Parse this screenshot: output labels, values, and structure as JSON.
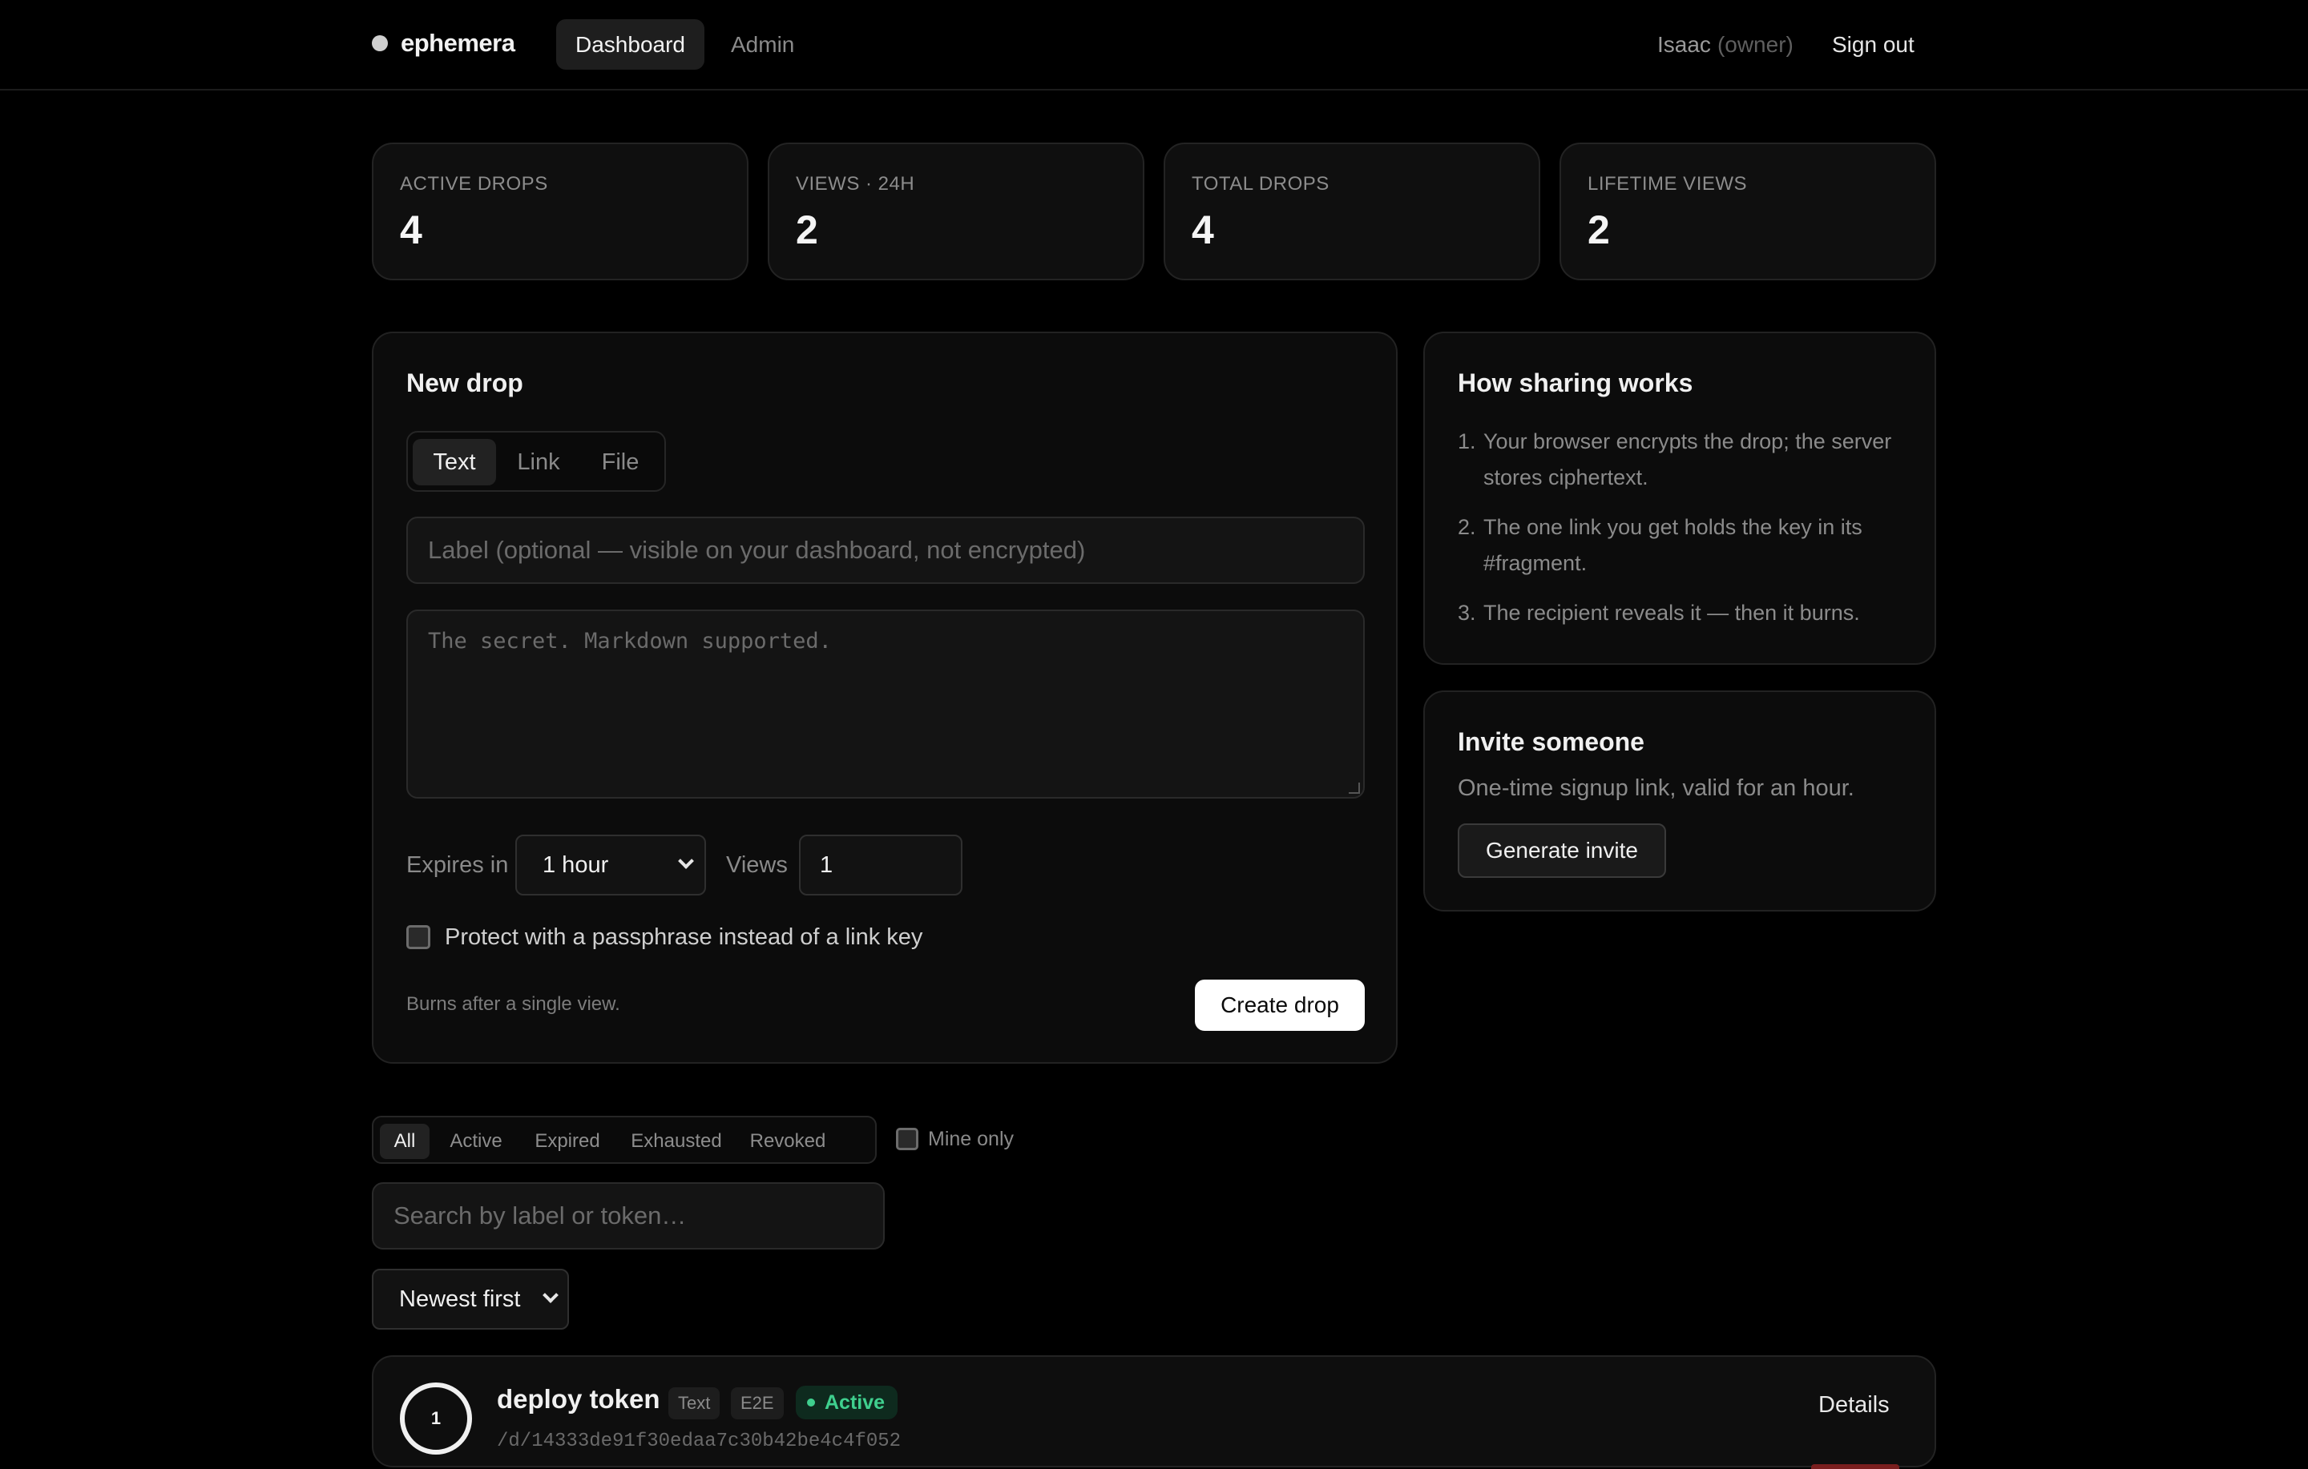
{
  "header": {
    "brand": "ephemera",
    "nav": [
      {
        "label": "Dashboard",
        "active": true
      },
      {
        "label": "Admin",
        "active": false
      }
    ],
    "user_name": "Isaac",
    "user_role": "(owner)",
    "sign_out": "Sign out"
  },
  "stats": [
    {
      "label": "ACTIVE DROPS",
      "value": "4"
    },
    {
      "label": "VIEWS · 24H",
      "value": "2"
    },
    {
      "label": "TOTAL DROPS",
      "value": "4"
    },
    {
      "label": "LIFETIME VIEWS",
      "value": "2"
    }
  ],
  "new_drop": {
    "title": "New drop",
    "tabs": [
      "Text",
      "Link",
      "File"
    ],
    "active_tab": "Text",
    "label_placeholder": "Label (optional — visible on your dashboard, not encrypted)",
    "secret_placeholder": "The secret. Markdown supported.",
    "expires_label": "Expires in",
    "expires_value": "1 hour",
    "views_label": "Views",
    "views_value": "1",
    "passphrase_label": "Protect with a passphrase instead of a link key",
    "burn_note": "Burns after a single view.",
    "create_button": "Create drop"
  },
  "how_sharing": {
    "title": "How sharing works",
    "steps": [
      {
        "num": "1.",
        "text": "Your browser encrypts the drop; the server stores ciphertext."
      },
      {
        "num": "2.",
        "text": "The one link you get holds the key in its #fragment."
      },
      {
        "num": "3.",
        "text": "The recipient reveals it — then it burns."
      }
    ]
  },
  "invite": {
    "title": "Invite someone",
    "description": "One-time signup link, valid for an hour.",
    "button": "Generate invite"
  },
  "filters": {
    "options": [
      "All",
      "Active",
      "Expired",
      "Exhausted",
      "Revoked"
    ],
    "active": "All",
    "mine_only": "Mine only",
    "search_placeholder": "Search by label or token…",
    "sort_value": "Newest first"
  },
  "drops": [
    {
      "views_left": "1",
      "label": "deploy token",
      "tags": [
        "Text",
        "E2E"
      ],
      "status": "Active",
      "path": "/d/14333de91f30edaa7c30b42be4c4f052",
      "details": "Details"
    }
  ],
  "colors": {
    "background": "#000000",
    "card": "#0c0c0c",
    "active_status": "#3fcf8e"
  }
}
